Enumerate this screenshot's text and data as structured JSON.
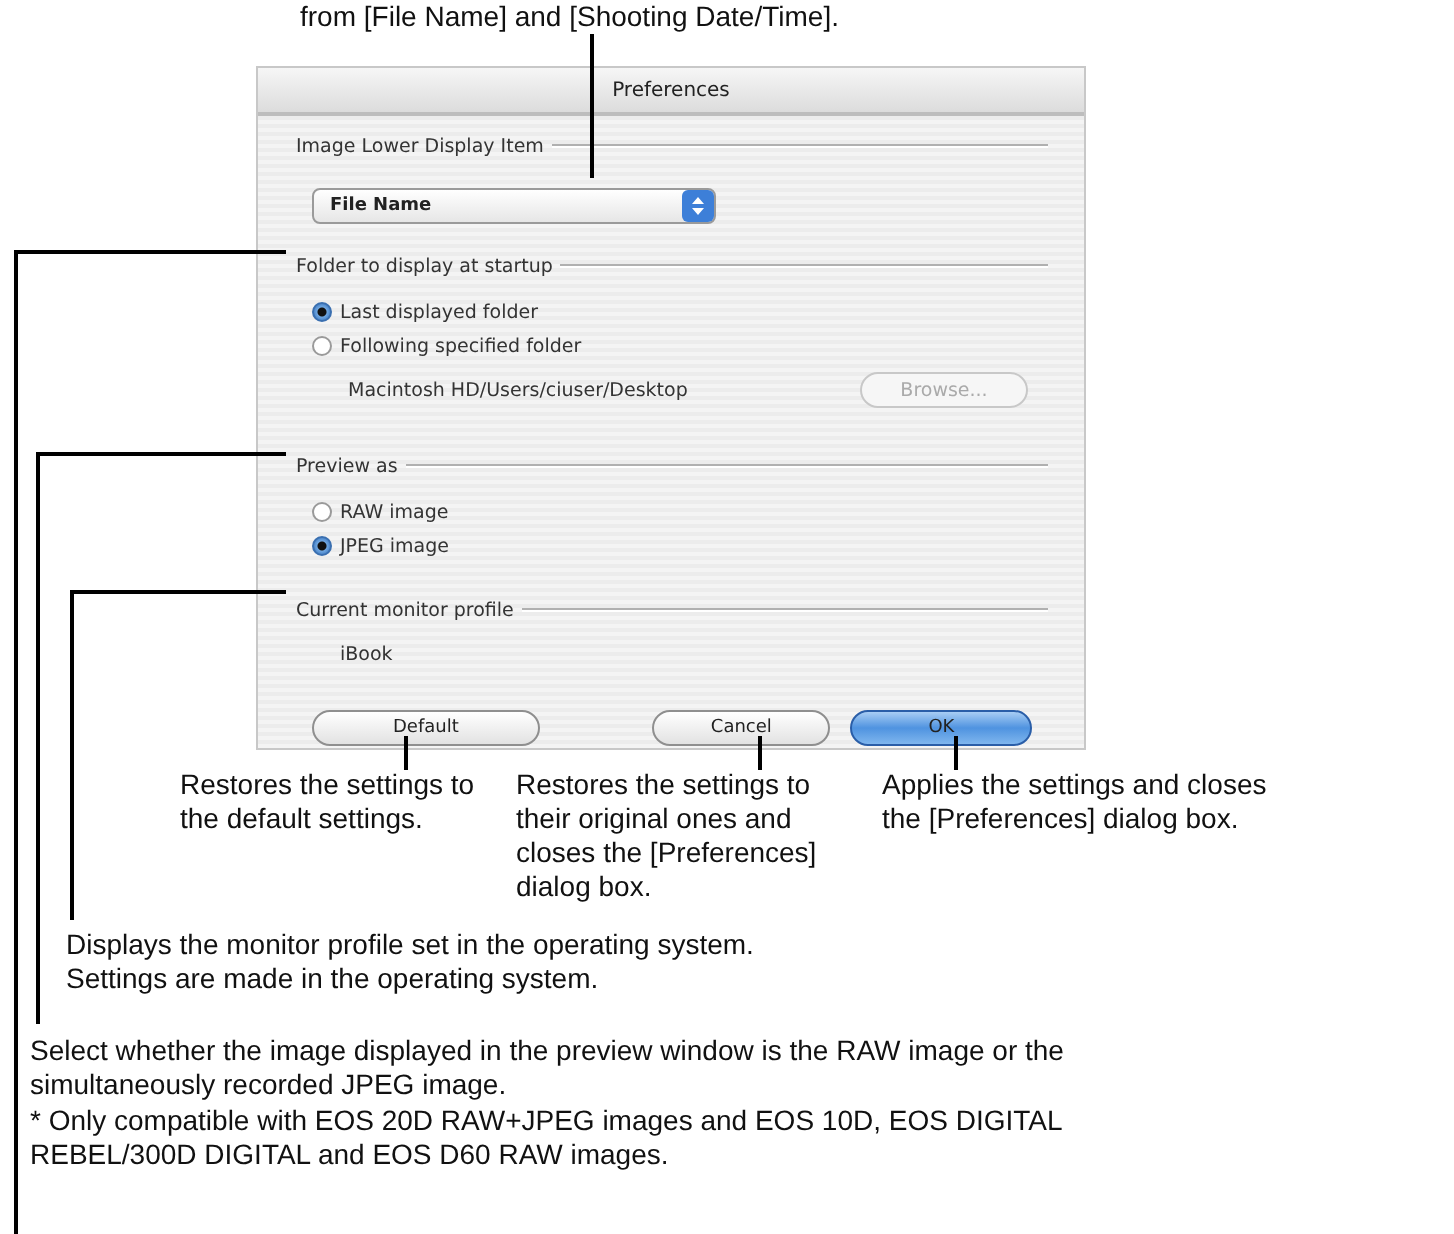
{
  "caption_top": "from [File Name] and [Shooting Date/Time].",
  "dialog": {
    "title": "Preferences",
    "sections": [
      {
        "kind": "dropdown",
        "heading": "Image Lower Display Item",
        "value": "File Name"
      },
      {
        "kind": "radios",
        "heading": "Folder to display at startup",
        "options": [
          {
            "label": "Last displayed folder",
            "selected": true
          },
          {
            "label": "Following specified folder",
            "selected": false
          }
        ],
        "path": "Macintosh HD/Users/ciuser/Desktop",
        "button": {
          "label": "Browse...",
          "disabled": true
        }
      },
      {
        "kind": "radios",
        "heading": "Preview as",
        "options": [
          {
            "label": "RAW image",
            "selected": false
          },
          {
            "label": "JPEG image",
            "selected": true
          }
        ]
      },
      {
        "kind": "text",
        "heading": "Current monitor profile",
        "value": "iBook"
      }
    ],
    "buttons": [
      {
        "label": "Default",
        "default": false
      },
      {
        "label": "Cancel",
        "default": false
      },
      {
        "label": "OK",
        "default": true
      }
    ]
  },
  "button_notes": [
    "Restores the settings to\nthe default settings.",
    "Restores the settings to\ntheir original ones and\ncloses the [Preferences]\ndialog box.",
    "Applies the settings and closes\nthe [Preferences] dialog box."
  ],
  "monitor_note": "Displays the monitor profile set in the operating system.\nSettings are made in the operating system.",
  "preview_note": "Select whether the image displayed in the preview window is the RAW image or the\nsimultaneously recorded JPEG image.",
  "footnote": "* Only compatible with EOS 20D RAW+JPEG images and EOS 10D, EOS DIGITAL\n  REBEL/300D DIGITAL and EOS D60 RAW images."
}
